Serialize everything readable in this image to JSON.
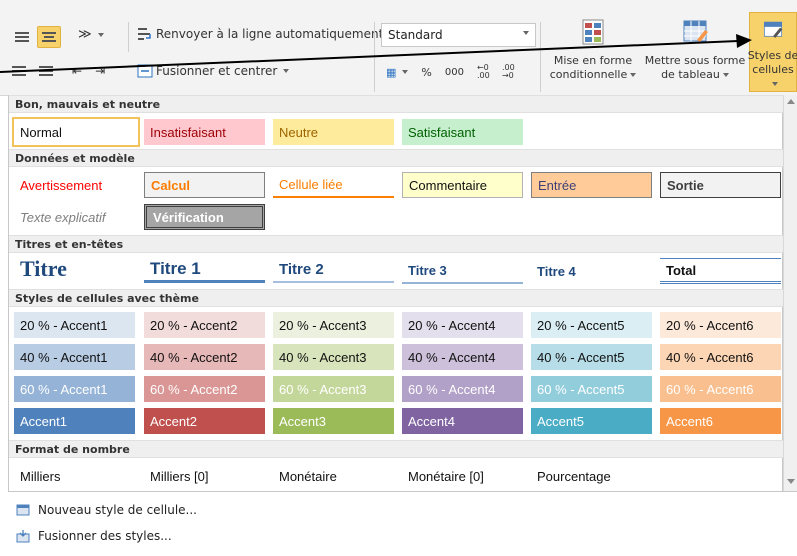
{
  "ribbon": {
    "wrap_text": "Renvoyer à la ligne automatiquement",
    "merge_center": "Fusionner et centrer",
    "number_format": "Standard",
    "percent": "%",
    "thousands": "000",
    "dec_increase": "←0 .00",
    "dec_decrease": ".00 →0",
    "conditional_line1": "Mise en forme",
    "conditional_line2": "conditionnelle",
    "table_line1": "Mettre sous forme",
    "table_line2": "de tableau",
    "styles_line1": "Styles de",
    "styles_line2": "cellules"
  },
  "gallery": {
    "sections": [
      {
        "title": "Bon, mauvais et neutre"
      },
      {
        "title": "Données et modèle"
      },
      {
        "title": "Titres et en-têtes"
      },
      {
        "title": "Styles de cellules avec thème"
      },
      {
        "title": "Format de nombre"
      }
    ],
    "good_bad": [
      "Normal",
      "Insatisfaisant",
      "Neutre",
      "Satisfaisant"
    ],
    "data_model_row1": [
      "Avertissement",
      "Calcul",
      "Cellule liée",
      "Commentaire",
      "Entrée",
      "Sortie"
    ],
    "data_model_row2": [
      "Texte explicatif",
      "Vérification"
    ],
    "titles": [
      "Titre",
      "Titre 1",
      "Titre 2",
      "Titre 3",
      "Titre 4",
      "Total"
    ],
    "accent20": [
      "20 % - Accent1",
      "20 % - Accent2",
      "20 % - Accent3",
      "20 % - Accent4",
      "20 % - Accent5",
      "20 % - Accent6"
    ],
    "accent40": [
      "40 % - Accent1",
      "40 % - Accent2",
      "40 % - Accent3",
      "40 % - Accent4",
      "40 % - Accent5",
      "40 % - Accent6"
    ],
    "accent60": [
      "60 % - Accent1",
      "60 % - Accent2",
      "60 % - Accent3",
      "60 % - Accent4",
      "60 % - Accent5",
      "60 % - Accent6"
    ],
    "accent100": [
      "Accent1",
      "Accent2",
      "Accent3",
      "Accent4",
      "Accent5",
      "Accent6"
    ],
    "number_formats": [
      "Milliers",
      "Milliers [0]",
      "Monétaire",
      "Monétaire [0]",
      "Pourcentage"
    ]
  },
  "footer": {
    "new_style": "Nouveau style de cellule...",
    "merge_styles": "Fusionner des styles..."
  },
  "colors": {
    "accent1": "#4f81bd",
    "accent2": "#c0504d",
    "accent3": "#9bbb59",
    "accent4": "#8064a2",
    "accent5": "#4bacc6",
    "accent6": "#f79646",
    "selection": "#f7d26b"
  }
}
